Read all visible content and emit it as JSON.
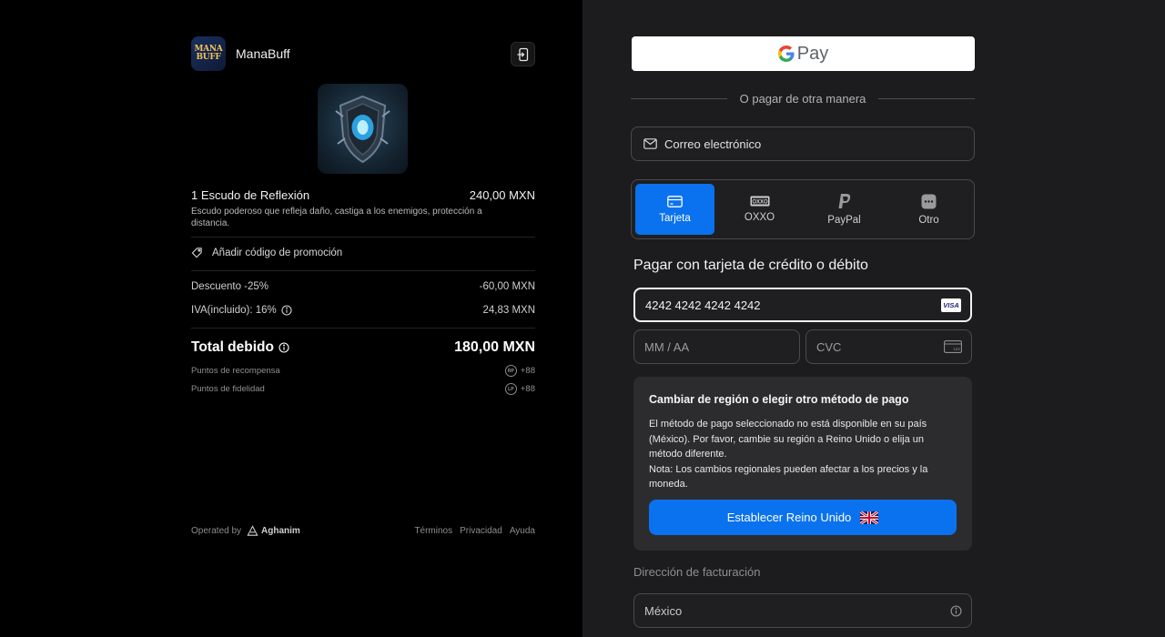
{
  "merchant": {
    "name": "ManaBuff",
    "logo_text_top": "MANA",
    "logo_text_bottom": "BUFF"
  },
  "item": {
    "title": "1 Escudo de Reflexión",
    "price": "240,00 MXN",
    "description": "Escudo poderoso que refleja daño, castiga a los enemigos, protección a distancia."
  },
  "promo": {
    "label": "Añadir código de promoción"
  },
  "summary": {
    "discount_label": "Descuento -25%",
    "discount_value": "-60,00 MXN",
    "tax_label": "IVA(incluido): 16%",
    "tax_value": "24,83 MXN",
    "total_label": "Total debido",
    "total_value": "180,00 MXN",
    "reward_label": "Puntos de recompensa",
    "reward_badge": "RP",
    "reward_value": "+88",
    "loyalty_label": "Puntos de fidelidad",
    "loyalty_badge": "LP",
    "loyalty_value": "+88"
  },
  "footer": {
    "operated_by": "Operated by",
    "brand": "Aghanim",
    "links": [
      "Términos",
      "Privacidad",
      "Ayuda"
    ]
  },
  "payment": {
    "gpay_label": "Pay",
    "or_text": "O pagar de otra manera",
    "email_placeholder": "Correo electrónico",
    "methods": [
      {
        "label": "Tarjeta",
        "icon": "card-icon",
        "active": true
      },
      {
        "label": "OXXO",
        "icon": "oxxo-icon",
        "active": false
      },
      {
        "label": "PayPal",
        "icon": "paypal-icon",
        "active": false
      },
      {
        "label": "Otro",
        "icon": "more-icon",
        "active": false
      }
    ],
    "card_heading": "Pagar con tarjeta de crédito o débito",
    "card_number": "4242 4242 4242 4242",
    "card_brand": "VISA",
    "expiry_placeholder": "MM / AA",
    "cvc_placeholder": "CVC",
    "cvc_icon_text": "123"
  },
  "region_notice": {
    "title": "Cambiar de región o elegir otro método de pago",
    "line1": "El método de pago seleccionado no está disponible en su país (México). Por favor, cambie su región a Reino Unido o elija un método diferente.",
    "line2": "Nota: Los cambios regionales pueden afectar a los precios y la moneda.",
    "button": "Establecer Reino Unido"
  },
  "billing": {
    "label": "Dirección de facturación",
    "country": "México"
  },
  "colors": {
    "accent": "#0a72ef",
    "left_bg": "#000000",
    "right_bg": "#1c1c1e"
  }
}
